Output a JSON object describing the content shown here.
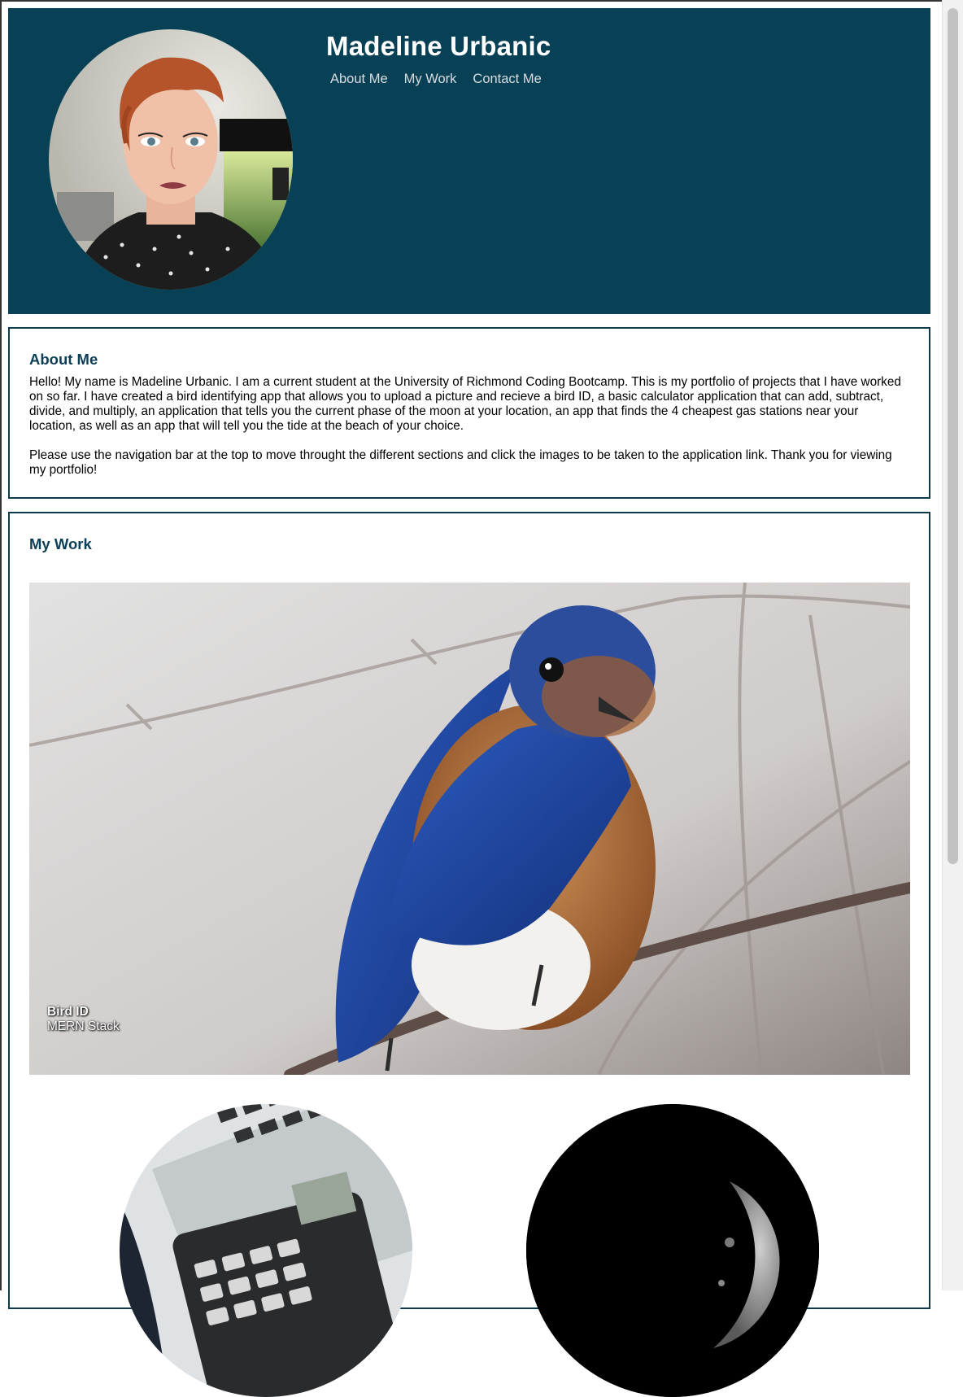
{
  "header": {
    "title": "Madeline Urbanic",
    "nav": [
      "About Me",
      "My Work",
      "Contact Me"
    ],
    "background_color": "#084156"
  },
  "about": {
    "heading": "About Me",
    "paragraphs": [
      "Hello! My name is Madeline Urbanic. I am a current student at the University of Richmond Coding Bootcamp. This is my portfolio of projects that I have worked on so far. I have created a bird identifying app that allows you to upload a picture and recieve a bird ID, a basic calculator application that can add, subtract, divide, and multiply, an application that tells you the current phase of the moon at your location, an app that finds the 4 cheapest gas stations near your location, as well as an app that will tell you the tide at the beach of your choice.",
      "Please use the navigation bar at the top to move throught the different sections and click the images to be taken to the application link. Thank you for viewing my portfolio!"
    ]
  },
  "work": {
    "heading": "My Work",
    "featured": {
      "name": "Bird ID",
      "stack": "MERN Stack"
    }
  },
  "colors": {
    "accent": "#0c3f55",
    "border": "#0c3a4d"
  },
  "icons": {
    "avatar": "profile-photo",
    "featured": "bluebird-photo",
    "calculator": "calculator-photo",
    "moon": "moon-photo"
  }
}
